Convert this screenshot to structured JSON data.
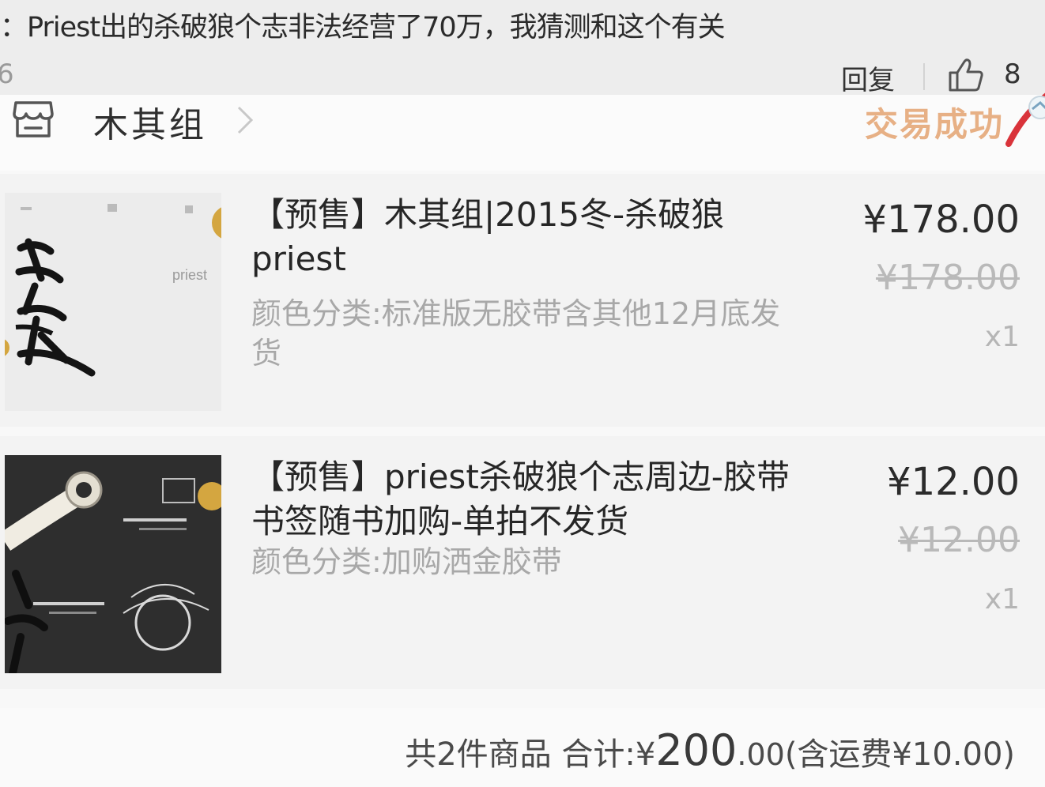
{
  "comment": {
    "text": "：Priest出的杀破狼个志非法经营了70万，我猜测和这个有关",
    "meta_left": "6",
    "reply_label": "回复",
    "like_count": "8"
  },
  "order": {
    "shop_name": "木其组",
    "status": "交易成功",
    "items": [
      {
        "title": "【预售】木其组|2015冬-杀破狼priest",
        "variant": "颜色分类:标准版无胶带含其他12月底发货",
        "price": "¥178.00",
        "original_price": "¥178.00",
        "quantity": "x1",
        "thumb_text": "priest"
      },
      {
        "title": "【预售】priest杀破狼个志周边-胶带书签随书加购-单拍不发货",
        "variant": "颜色分类:加购洒金胶带",
        "price": "¥12.00",
        "original_price": "¥12.00",
        "quantity": "x1"
      }
    ],
    "summary": {
      "prefix": "共2件商品 合计:¥",
      "total_int": "200",
      "total_dec": ".00",
      "shipping": "(含运费¥10.00)"
    }
  },
  "colors": {
    "status_accent": "#e7b085",
    "gold": "#d4a640"
  },
  "icons": [
    "thumb-up-icon",
    "store-icon",
    "chevron-right-icon"
  ]
}
